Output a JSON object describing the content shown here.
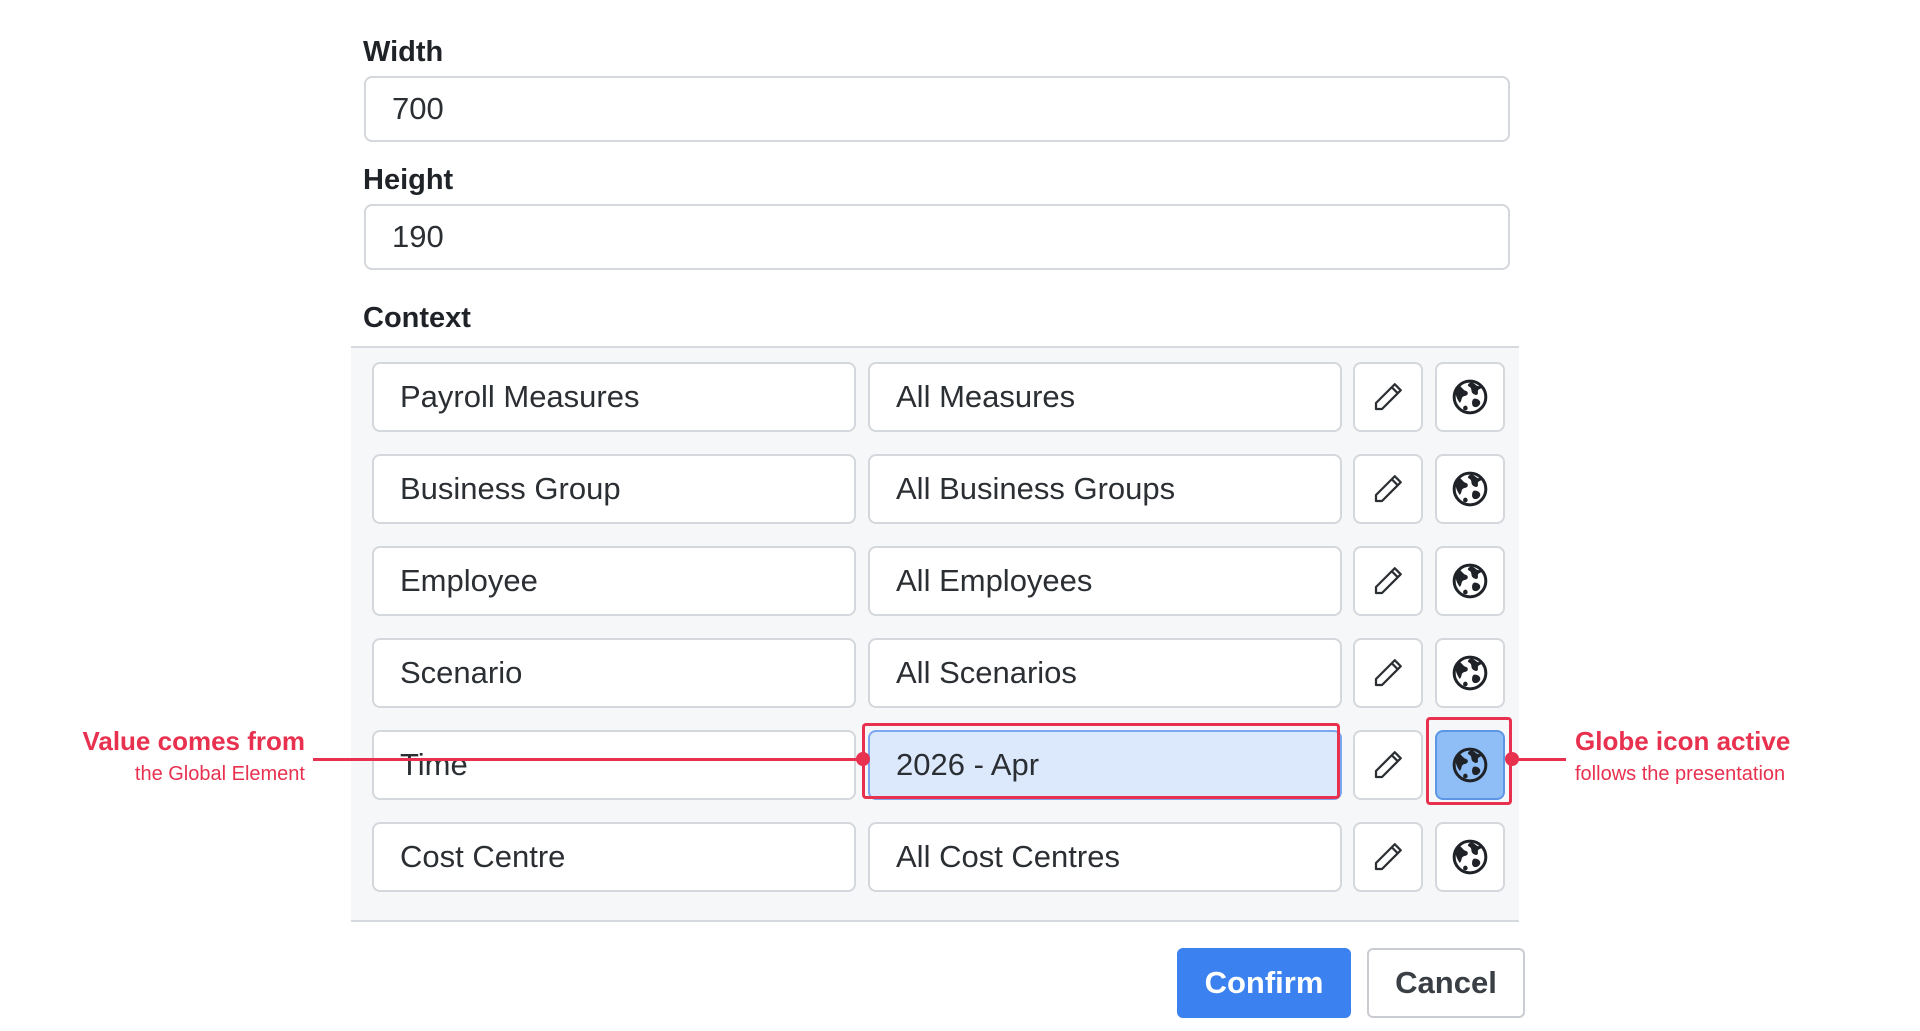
{
  "form": {
    "width_label": "Width",
    "width_value": "700",
    "height_label": "Height",
    "height_value": "190",
    "context_label": "Context"
  },
  "context_rows": [
    {
      "name": "Payroll Measures",
      "value": "All Measures",
      "edit_icon": "pencil-icon",
      "globe_icon": "globe-icon",
      "globe_active": false
    },
    {
      "name": "Business Group",
      "value": "All Business Groups",
      "edit_icon": "pencil-icon",
      "globe_icon": "globe-icon",
      "globe_active": false
    },
    {
      "name": "Employee",
      "value": "All Employees",
      "edit_icon": "pencil-icon",
      "globe_icon": "globe-icon",
      "globe_active": false
    },
    {
      "name": "Scenario",
      "value": "All Scenarios",
      "edit_icon": "pencil-icon",
      "globe_icon": "globe-icon",
      "globe_active": false
    },
    {
      "name": "Time",
      "value": "2026 - Apr",
      "edit_icon": "pencil-icon",
      "globe_icon": "globe-icon",
      "globe_active": true
    },
    {
      "name": "Cost Centre",
      "value": "All Cost Centres",
      "edit_icon": "pencil-icon",
      "globe_icon": "globe-icon",
      "globe_active": false
    }
  ],
  "annotations": {
    "left_title": "Value comes from",
    "left_sub": "the Global Element",
    "right_title": "Globe icon active",
    "right_sub": "follows the presentation",
    "color": "#e8304f"
  },
  "buttons": {
    "confirm_label": "Confirm",
    "cancel_label": "Cancel"
  },
  "colors": {
    "accent": "#3b82f0",
    "active_value_bg": "#dce9fc",
    "active_globe_bg": "#8fbdf5"
  }
}
